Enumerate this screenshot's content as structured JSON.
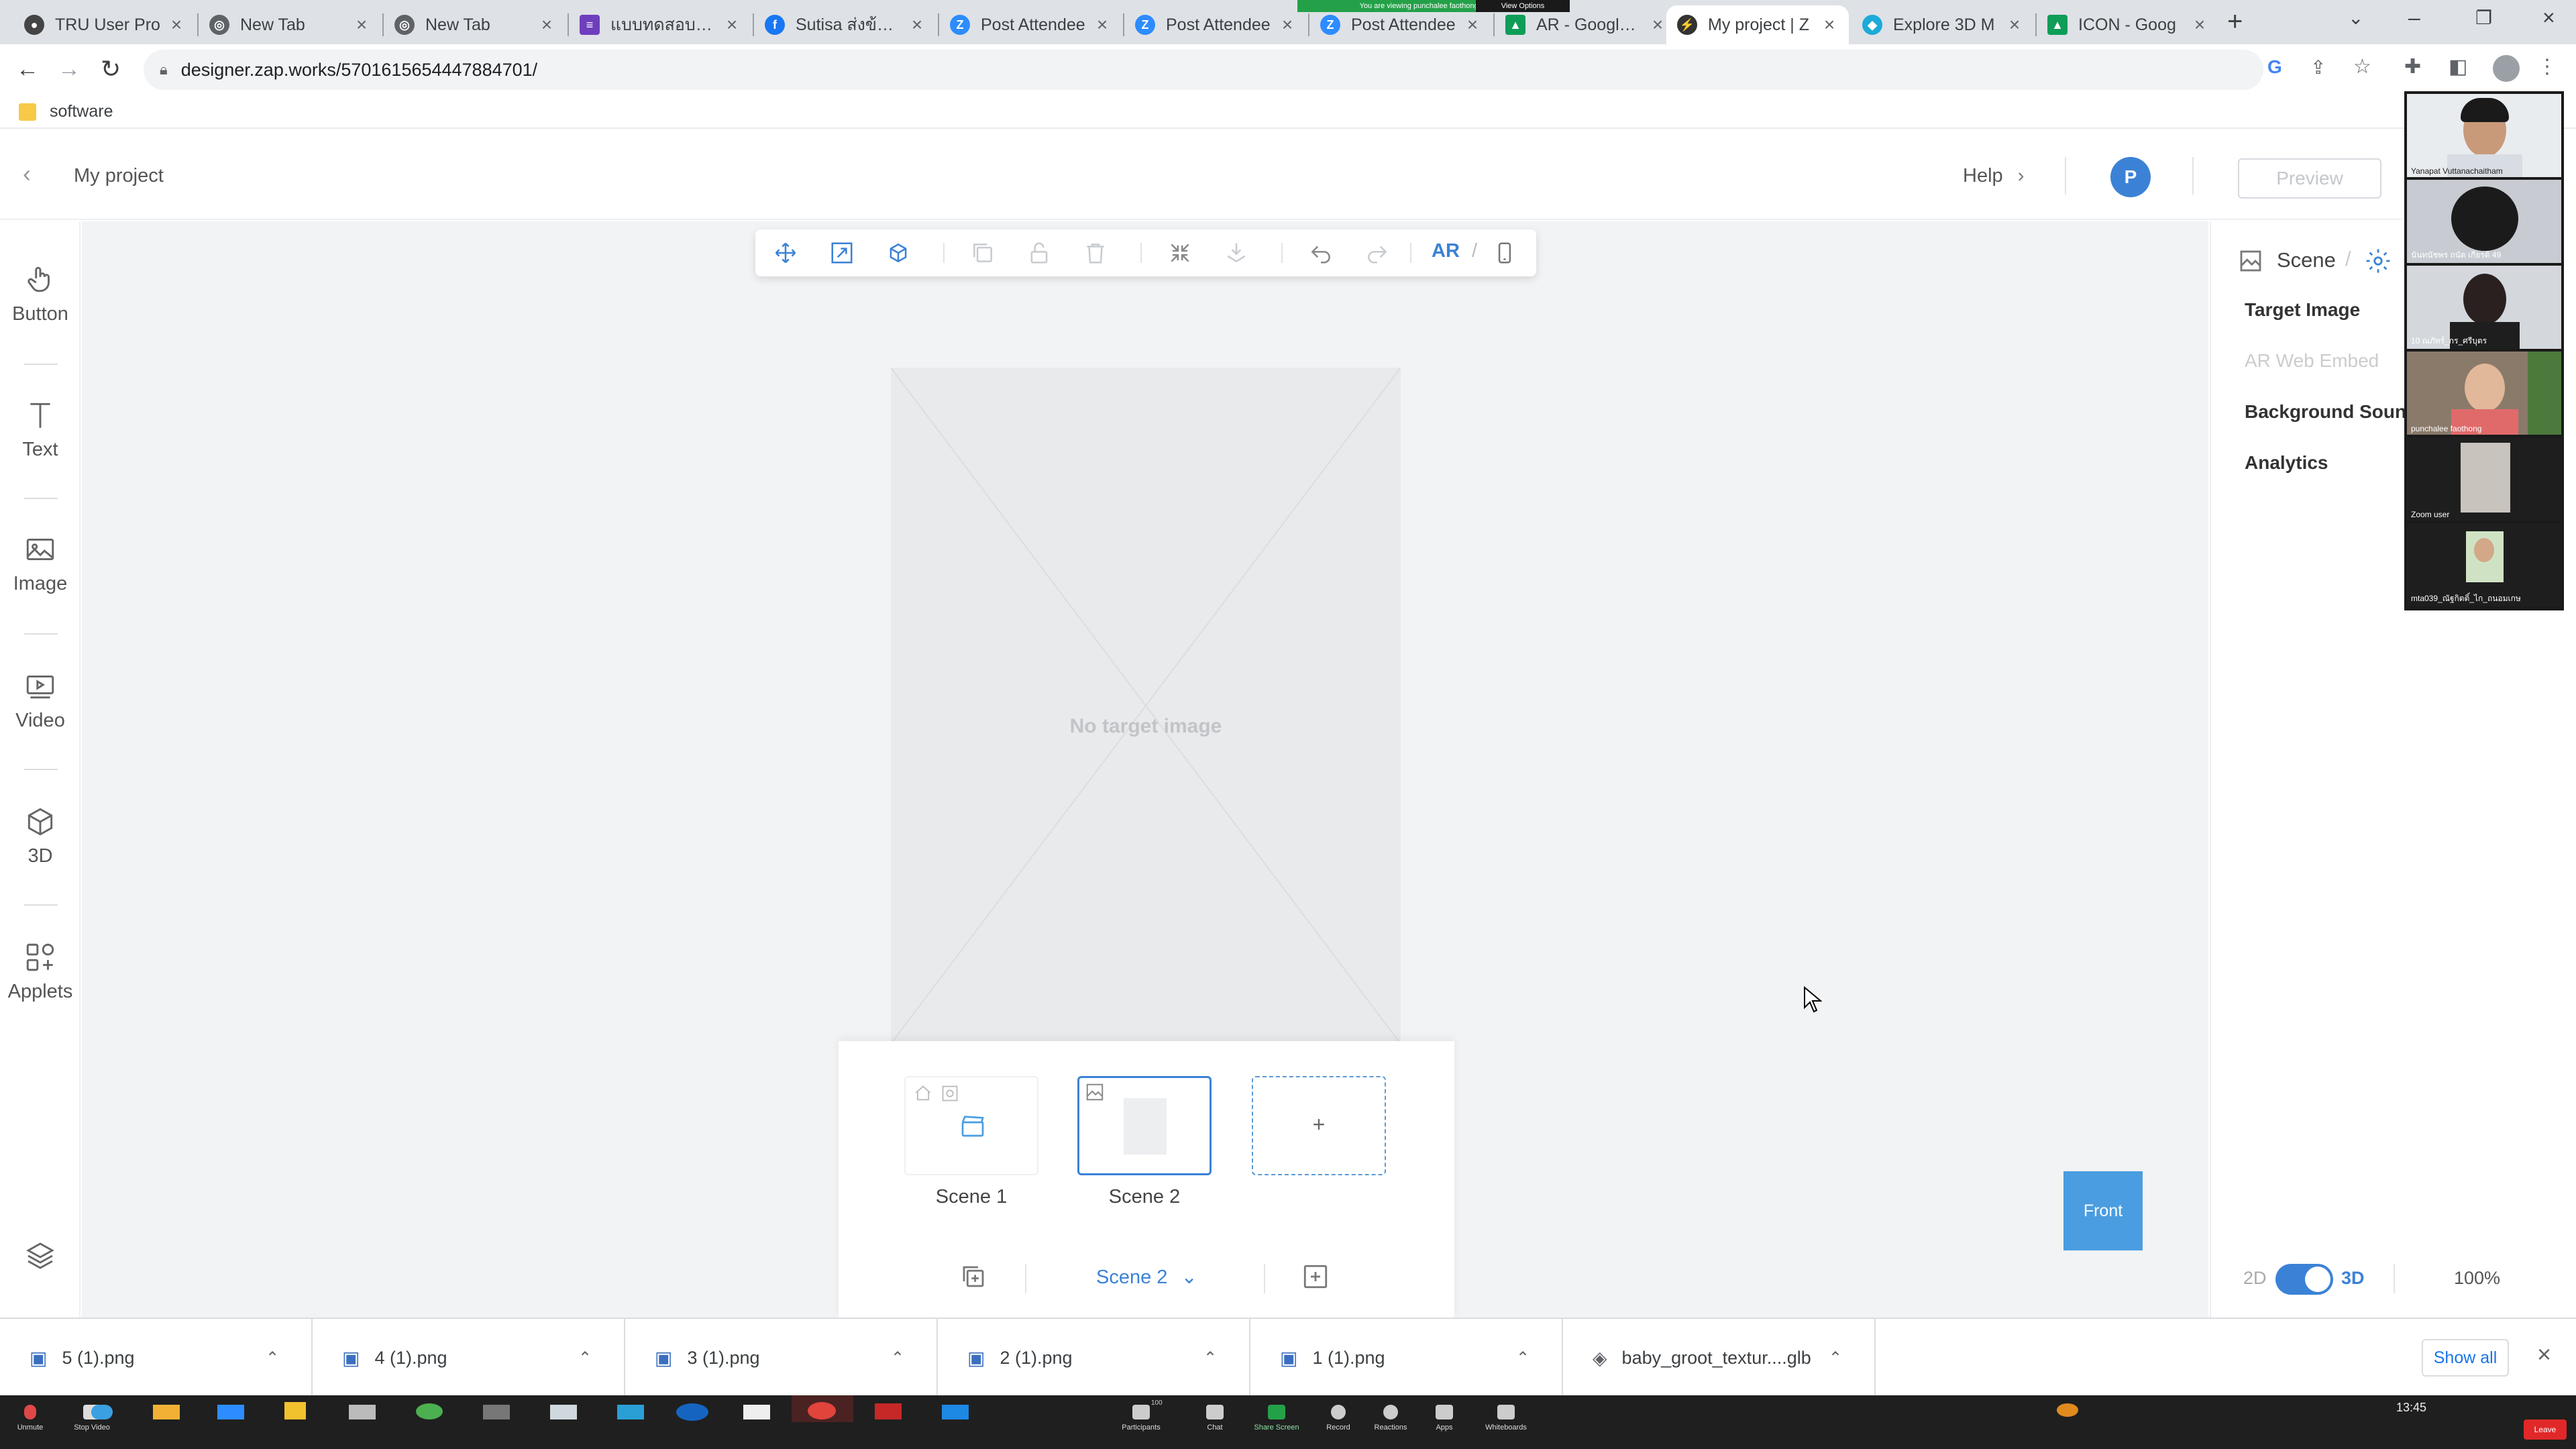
{
  "browser": {
    "tabs": [
      {
        "label": "TRU User Pro",
        "icon": "tru-icon"
      },
      {
        "label": "New Tab",
        "icon": "chrome-icon"
      },
      {
        "label": "New Tab",
        "icon": "chrome-icon"
      },
      {
        "label": "แบบทดสอบหลัง",
        "icon": "forms-icon"
      },
      {
        "label": "Sutisa ส่งข้อความ",
        "icon": "facebook-icon"
      },
      {
        "label": "Post Attendee",
        "icon": "zoom-icon"
      },
      {
        "label": "Post Attendee",
        "icon": "zoom-icon"
      },
      {
        "label": "Post Attendee",
        "icon": "zoom-icon"
      },
      {
        "label": "AR - Google D",
        "icon": "google-drive-icon"
      },
      {
        "label": "My project | Z",
        "icon": "zapworks-icon"
      },
      {
        "label": "Explore 3D M",
        "icon": "sketchfab-icon"
      },
      {
        "label": "ICON - Goog",
        "icon": "google-drive-icon"
      }
    ],
    "active_tab_index": 9,
    "share_notice": "You are viewing punchalee faothong's screen",
    "view_options": "View Options",
    "url": "designer.zap.works/5701615654447884701/",
    "bookmark": "software"
  },
  "app": {
    "project_title": "My project",
    "help_label": "Help",
    "avatar_letter": "P",
    "preview_label": "Preview",
    "tools": [
      {
        "label": "Button",
        "icon": "hand-pointer-icon"
      },
      {
        "label": "Text",
        "icon": "text-icon"
      },
      {
        "label": "Image",
        "icon": "image-icon"
      },
      {
        "label": "Video",
        "icon": "video-icon"
      },
      {
        "label": "3D",
        "icon": "cube-icon"
      },
      {
        "label": "Applets",
        "icon": "applets-icon"
      }
    ],
    "toolbar": {
      "ar_label": "AR",
      "ar_sep": "/"
    },
    "canvas": {
      "placeholder": "No target image"
    },
    "scenes": {
      "items": [
        {
          "label": "Scene 1"
        },
        {
          "label": "Scene 2"
        }
      ],
      "selected_index": 1,
      "add_label": "+",
      "current": "Scene 2"
    },
    "front_label": "Front",
    "right_panel": {
      "title": "Scene",
      "items": [
        "Target Image",
        "AR Web Embed",
        "Background Sound",
        "Analytics"
      ],
      "disabled_item": "AR Web Embed"
    },
    "view_toggle": {
      "label_2d": "2D",
      "label_3d": "3D",
      "state": "3D",
      "zoom": "100%"
    }
  },
  "zoom": {
    "participants": [
      {
        "name": "Yanapat Vuttanachaitham"
      },
      {
        "name": "นันทนัชพร ถนัด เกียรติ 49"
      },
      {
        "name": "10 ณภัทร์_กร_ศรีบุตร"
      },
      {
        "name": "punchalee faothong"
      },
      {
        "name": "Zoom user"
      },
      {
        "name": "mta039_ณัฐกิตติ์_ไก_ถนอมเกษ"
      }
    ],
    "controls": [
      "Unmute",
      "Stop Video",
      "Participants",
      "Chat",
      "Share Screen",
      "Record",
      "Reactions",
      "Apps",
      "Whiteboards"
    ],
    "participant_count": "100",
    "leave_label": "Leave",
    "clock": "13:45"
  },
  "downloads": {
    "items": [
      "5 (1).png",
      "4 (1).png",
      "3 (1).png",
      "2 (1).png",
      "1 (1).png",
      "baby_groot_textur....glb"
    ],
    "show_all": "Show all"
  },
  "colors": {
    "accent": "#3b82d6",
    "front_button": "#4a9de0",
    "canvas_bg": "#f2f3f5"
  }
}
